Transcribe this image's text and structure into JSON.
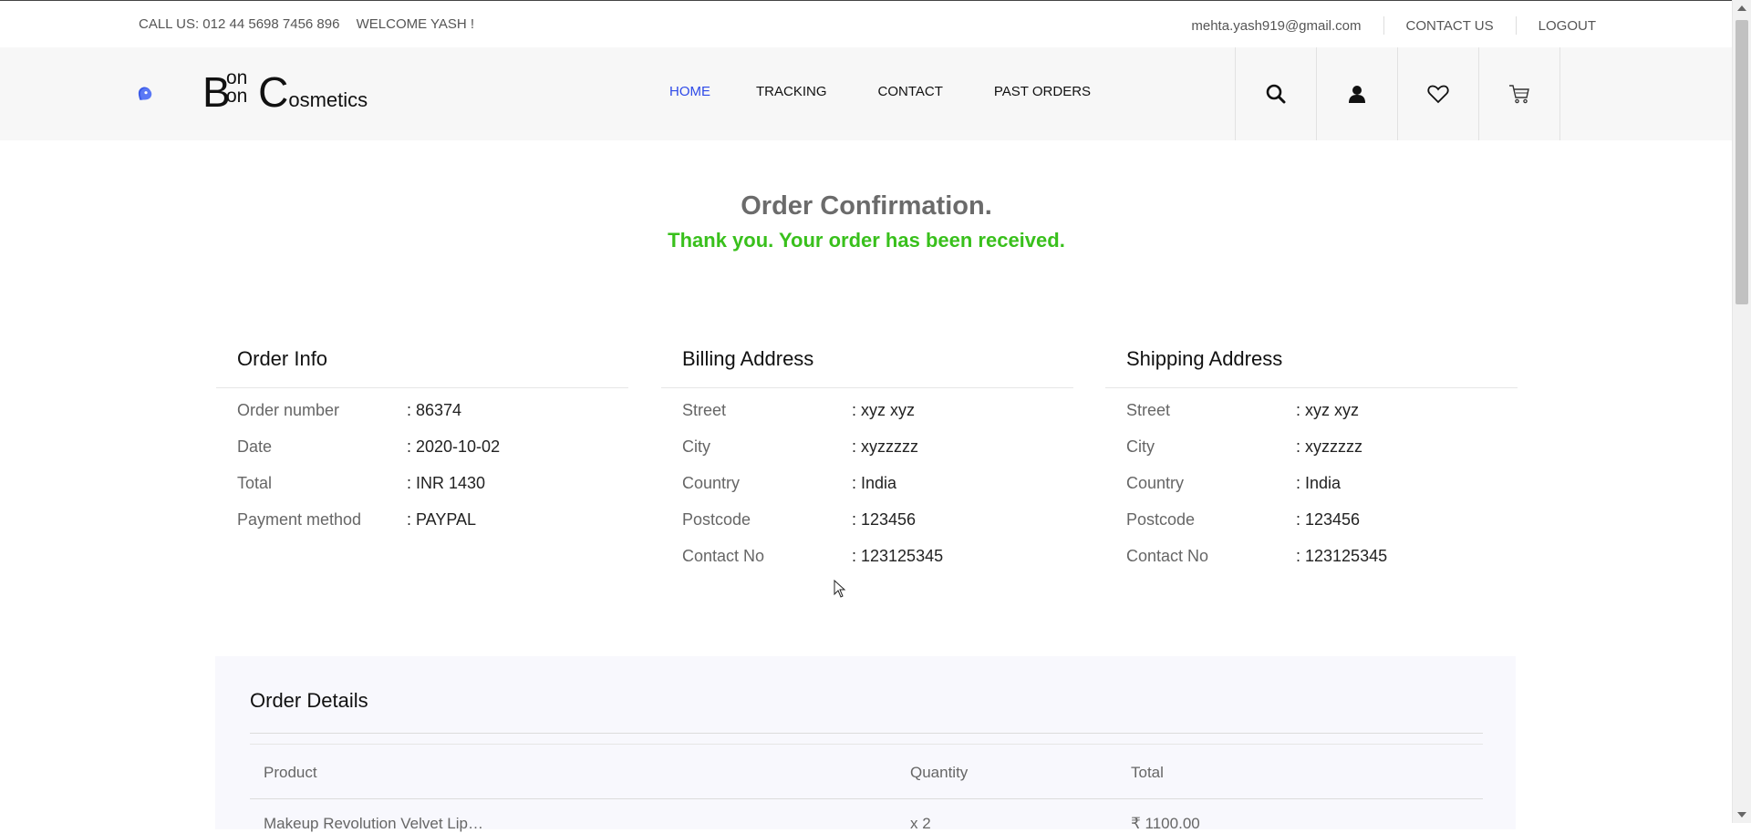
{
  "topbar": {
    "call_us": "CALL US: 012 44 5698 7456 896",
    "welcome": "WELCOME YASH !",
    "email": "mehta.yash919@gmail.com",
    "contact_us": "CONTACT US",
    "logout": "LOGOUT"
  },
  "logo": {
    "b1": "B",
    "on1": "on",
    "on2": "on",
    "c": "C",
    "osmetics": "osmetics"
  },
  "nav": {
    "home": "HOME",
    "tracking": "TRACKING",
    "contact": "CONTACT",
    "past_orders": "PAST ORDERS"
  },
  "colors": {
    "accent": "#2e4ae8",
    "success": "#39c01c",
    "logo_blue": "#4a6cf7"
  },
  "header_icons": [
    "search-icon",
    "user-icon",
    "heart-icon",
    "cart-icon"
  ],
  "confirmation": {
    "title": "Order Confirmation.",
    "message": "Thank you. Your order has been received."
  },
  "order_info": {
    "heading": "Order Info",
    "rows": [
      {
        "label": "Order number",
        "value": ": 86374"
      },
      {
        "label": "Date",
        "value": ": 2020-10-02"
      },
      {
        "label": "Total",
        "value": ": INR 1430"
      },
      {
        "label": "Payment method",
        "value": ": PAYPAL"
      }
    ]
  },
  "billing": {
    "heading": "Billing Address",
    "rows": [
      {
        "label": "Street",
        "value": ": xyz xyz"
      },
      {
        "label": "City",
        "value": ": xyzzzzz"
      },
      {
        "label": "Country",
        "value": ": India"
      },
      {
        "label": "Postcode",
        "value": ": 123456"
      },
      {
        "label": "Contact No",
        "value": ": 123125345"
      }
    ]
  },
  "shipping": {
    "heading": "Shipping Address",
    "rows": [
      {
        "label": "Street",
        "value": ": xyz xyz"
      },
      {
        "label": "City",
        "value": ": xyzzzzz"
      },
      {
        "label": "Country",
        "value": ": India"
      },
      {
        "label": "Postcode",
        "value": ": 123456"
      },
      {
        "label": "Contact No",
        "value": ": 123125345"
      }
    ]
  },
  "order_details": {
    "heading": "Order Details",
    "columns": [
      "Product",
      "Quantity",
      "Total"
    ],
    "partial_row": [
      "Makeup Revolution Velvet Lip…",
      "x 2",
      "₹ 1100.00"
    ]
  }
}
